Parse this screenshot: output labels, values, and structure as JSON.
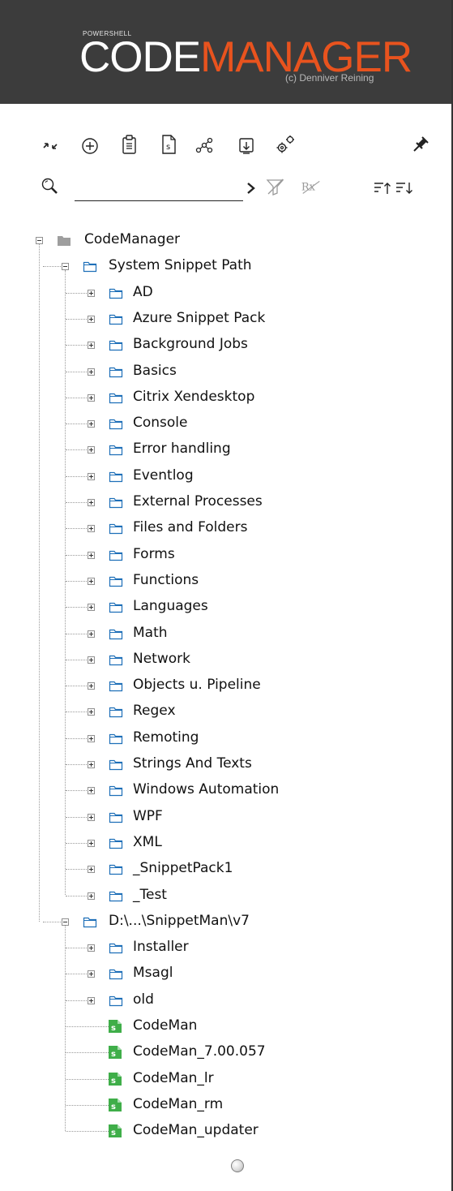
{
  "header": {
    "small_title": "POWERSHELL",
    "title_part1": "CODE",
    "title_part2": "MANAGER",
    "copyright": "(c) Denniver Reining",
    "accent_color": "#e8531e",
    "background_color": "#3c3c3c"
  },
  "toolbar": {
    "icons": [
      {
        "name": "refresh-icon"
      },
      {
        "name": "add-icon"
      },
      {
        "name": "paste-icon"
      },
      {
        "name": "snippet-icon"
      },
      {
        "name": "graph-icon"
      },
      {
        "name": "save-icon"
      },
      {
        "name": "settings-icon"
      },
      {
        "name": "pin-icon"
      }
    ]
  },
  "search": {
    "value": "",
    "icons": [
      "search-icon",
      "search-go-icon",
      "clear-filter-icon",
      "regex-icon",
      "sort-ascending-icon",
      "sort-descending-icon"
    ]
  },
  "tree": {
    "root": {
      "label": "CodeManager",
      "expanded": true
    },
    "system": {
      "label": "System Snippet Path",
      "expanded": true
    },
    "system_folders": [
      "AD",
      "Azure Snippet Pack",
      "Background Jobs",
      "Basics",
      "Citrix Xendesktop",
      "Console",
      "Error handling",
      "Eventlog",
      "External Processes",
      "Files and Folders",
      "Forms",
      "Functions",
      "Languages",
      "Math",
      "Network",
      "Objects u. Pipeline",
      "Regex",
      "Remoting",
      "Strings And Texts",
      "Windows Automation",
      "WPF",
      "XML",
      "_SnippetPack1",
      "_Test"
    ],
    "user": {
      "label": "D:\\...\\SnippetMan\\v7",
      "expanded": true
    },
    "user_folders": [
      "Installer",
      "Msagl",
      "old"
    ],
    "user_files": [
      "CodeMan",
      "CodeMan_7.00.057",
      "CodeMan_lr",
      "CodeMan_rm",
      "CodeMan_updater"
    ]
  },
  "status": {
    "indicator": "idle"
  },
  "colors": {
    "script_icon": "#3fae49",
    "folder_outline": "#1e6fb8"
  }
}
